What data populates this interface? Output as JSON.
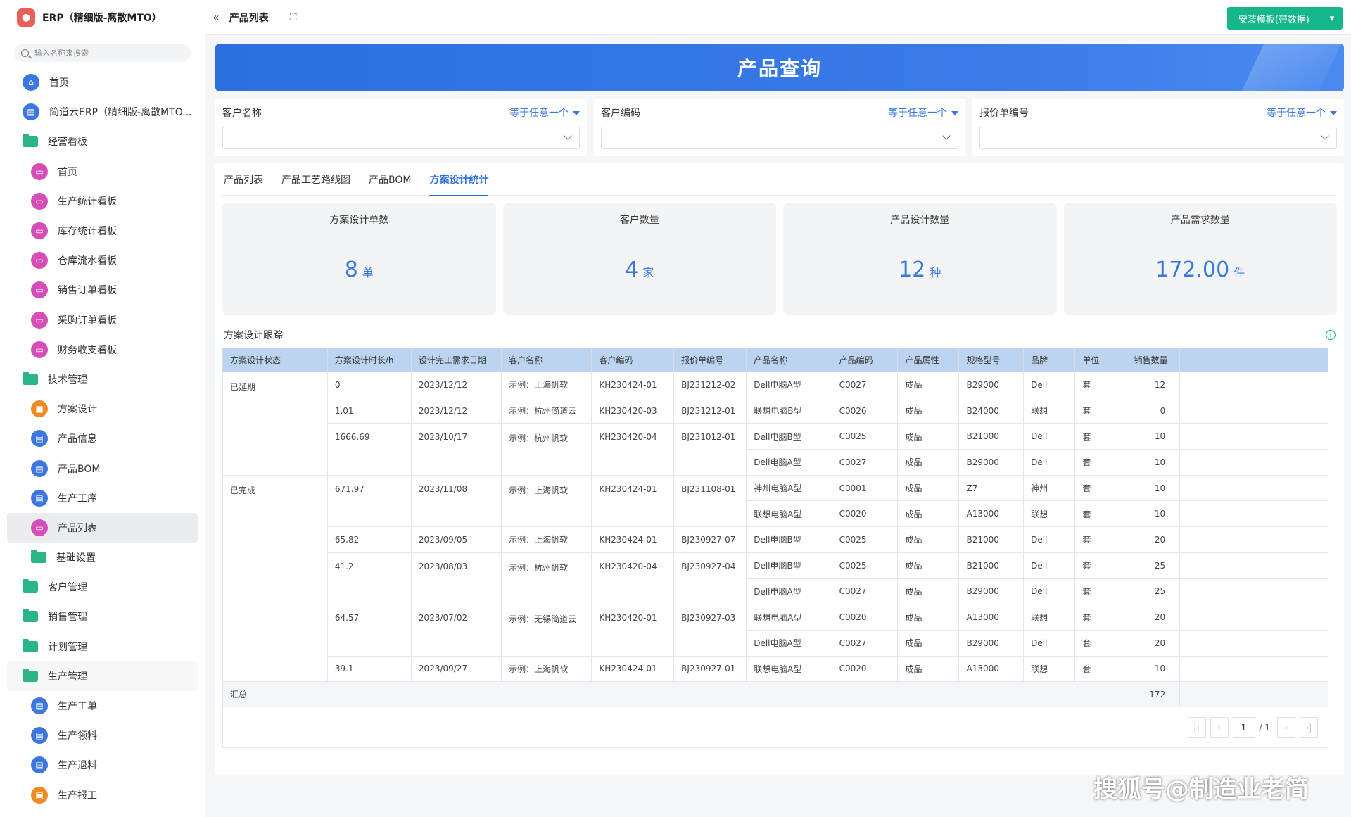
{
  "app": {
    "title": "ERP（精细版-离散MTO）",
    "search_placeholder": "输入名称来搜索"
  },
  "sidebar": {
    "items": [
      {
        "label": "首页",
        "icon": "home-icon",
        "type": "top",
        "color": "blue"
      },
      {
        "label": "简道云ERP（精细版-离散MTO...",
        "icon": "doc-icon",
        "type": "top",
        "color": "blue"
      },
      {
        "label": "经营看板",
        "icon": "folder-icon",
        "type": "folder"
      },
      {
        "label": "首页",
        "icon": "dashboard-icon",
        "type": "sub",
        "color": "pink"
      },
      {
        "label": "生产统计看板",
        "icon": "dashboard-icon",
        "type": "sub",
        "color": "pink"
      },
      {
        "label": "库存统计看板",
        "icon": "dashboard-icon",
        "type": "sub",
        "color": "pink"
      },
      {
        "label": "仓库流水看板",
        "icon": "dashboard-icon",
        "type": "sub",
        "color": "pink"
      },
      {
        "label": "销售订单看板",
        "icon": "dashboard-icon",
        "type": "sub",
        "color": "pink"
      },
      {
        "label": "采购订单看板",
        "icon": "dashboard-icon",
        "type": "sub",
        "color": "pink"
      },
      {
        "label": "财务收支看板",
        "icon": "dashboard-icon",
        "type": "sub",
        "color": "pink"
      },
      {
        "label": "技术管理",
        "icon": "folder-icon",
        "type": "folder"
      },
      {
        "label": "方案设计",
        "icon": "workflow-icon",
        "type": "sub",
        "color": "orange"
      },
      {
        "label": "产品信息",
        "icon": "form-icon",
        "type": "sub",
        "color": "blue"
      },
      {
        "label": "产品BOM",
        "icon": "form-icon",
        "type": "sub",
        "color": "blue"
      },
      {
        "label": "生产工序",
        "icon": "form-icon",
        "type": "sub",
        "color": "blue"
      },
      {
        "label": "产品列表",
        "icon": "dashboard-icon",
        "type": "sub",
        "color": "pink",
        "active": true
      },
      {
        "label": "基础设置",
        "icon": "folder-icon",
        "type": "subfolder"
      },
      {
        "label": "客户管理",
        "icon": "folder-icon",
        "type": "folder"
      },
      {
        "label": "销售管理",
        "icon": "folder-icon",
        "type": "folder"
      },
      {
        "label": "计划管理",
        "icon": "folder-icon",
        "type": "folder"
      },
      {
        "label": "生产管理",
        "icon": "folder-icon",
        "type": "folder",
        "group": true
      },
      {
        "label": "生产工单",
        "icon": "form-icon",
        "type": "sub",
        "color": "blue"
      },
      {
        "label": "生产领料",
        "icon": "form-icon",
        "type": "sub",
        "color": "blue"
      },
      {
        "label": "生产退料",
        "icon": "form-icon",
        "type": "sub",
        "color": "blue"
      },
      {
        "label": "生产报工",
        "icon": "workflow-icon",
        "type": "sub",
        "color": "orange"
      }
    ]
  },
  "topbar": {
    "collapse": "«",
    "breadcrumb": "产品列表",
    "fullscreen": "⛶",
    "install_label": "安装模板(带数据)"
  },
  "banner": {
    "title": "产品查询"
  },
  "filters": [
    {
      "label": "客户名称",
      "op": "等于任意一个"
    },
    {
      "label": "客户编码",
      "op": "等于任意一个"
    },
    {
      "label": "报价单编号",
      "op": "等于任意一个"
    }
  ],
  "tabs": [
    {
      "label": "产品列表"
    },
    {
      "label": "产品工艺路线图"
    },
    {
      "label": "产品BOM"
    },
    {
      "label": "方案设计统计",
      "active": true
    }
  ],
  "cards": [
    {
      "title": "方案设计单数",
      "value": "8",
      "unit": "单"
    },
    {
      "title": "客户数量",
      "value": "4",
      "unit": "家"
    },
    {
      "title": "产品设计数量",
      "value": "12",
      "unit": "种"
    },
    {
      "title": "产品需求数量",
      "value": "172.00",
      "unit": "件"
    }
  ],
  "section": {
    "title": "方案设计跟踪"
  },
  "table": {
    "headers": [
      "方案设计状态",
      "方案设计时长/h",
      "设计完工需求日期",
      "客户名称",
      "客户编码",
      "报价单编号",
      "产品名称",
      "产品编码",
      "产品属性",
      "规格型号",
      "品牌",
      "单位",
      "销售数量"
    ],
    "rows": [
      [
        "已延期",
        "0",
        "2023/12/12",
        "示例：上海帆软",
        "KH230424-01",
        "BJ231212-02",
        "Dell电脑A型",
        "C0027",
        "成品",
        "B29000",
        "Dell",
        "套",
        "12"
      ],
      [
        "",
        "1.01",
        "2023/12/12",
        "示例：杭州简道云",
        "KH230420-03",
        "BJ231212-01",
        "联想电脑B型",
        "C0026",
        "成品",
        "B24000",
        "联想",
        "套",
        "0"
      ],
      [
        "",
        "1666.69",
        "2023/10/17",
        "示例：杭州帆软",
        "KH230420-04",
        "BJ231012-01",
        "Dell电脑B型",
        "C0025",
        "成品",
        "B21000",
        "Dell",
        "套",
        "10"
      ],
      [
        "",
        "",
        "",
        "",
        "",
        "",
        "Dell电脑A型",
        "C0027",
        "成品",
        "B29000",
        "Dell",
        "套",
        "10"
      ],
      [
        "已完成",
        "671.97",
        "2023/11/08",
        "示例：上海帆软",
        "KH230424-01",
        "BJ231108-01",
        "神州电脑A型",
        "C0001",
        "成品",
        "Z7",
        "神州",
        "套",
        "10"
      ],
      [
        "",
        "",
        "",
        "",
        "",
        "",
        "联想电脑A型",
        "C0020",
        "成品",
        "A13000",
        "联想",
        "套",
        "10"
      ],
      [
        "",
        "65.82",
        "2023/09/05",
        "示例：上海帆软",
        "KH230424-01",
        "BJ230927-07",
        "Dell电脑B型",
        "C0025",
        "成品",
        "B21000",
        "Dell",
        "套",
        "20"
      ],
      [
        "",
        "41.2",
        "2023/08/03",
        "示例：杭州帆软",
        "KH230420-04",
        "BJ230927-04",
        "Dell电脑B型",
        "C0025",
        "成品",
        "B21000",
        "Dell",
        "套",
        "25"
      ],
      [
        "",
        "",
        "",
        "",
        "",
        "",
        "Dell电脑A型",
        "C0027",
        "成品",
        "B29000",
        "Dell",
        "套",
        "25"
      ],
      [
        "",
        "64.57",
        "2023/07/02",
        "示例：无锡简道云",
        "KH230420-01",
        "BJ230927-03",
        "联想电脑A型",
        "C0020",
        "成品",
        "A13000",
        "联想",
        "套",
        "20"
      ],
      [
        "",
        "",
        "",
        "",
        "",
        "",
        "Dell电脑A型",
        "C0027",
        "成品",
        "B29000",
        "Dell",
        "套",
        "20"
      ],
      [
        "",
        "39.1",
        "2023/09/27",
        "示例：上海帆软",
        "KH230424-01",
        "BJ230927-01",
        "联想电脑A型",
        "C0020",
        "成品",
        "A13000",
        "联想",
        "套",
        "10"
      ]
    ],
    "summary_label": "汇总",
    "summary_total": "172"
  },
  "pager": {
    "first": "|‹",
    "prev": "‹",
    "current": "1",
    "total": "/ 1",
    "next": "›",
    "last": "›|"
  },
  "watermark": "搜狐号@制造业老简"
}
